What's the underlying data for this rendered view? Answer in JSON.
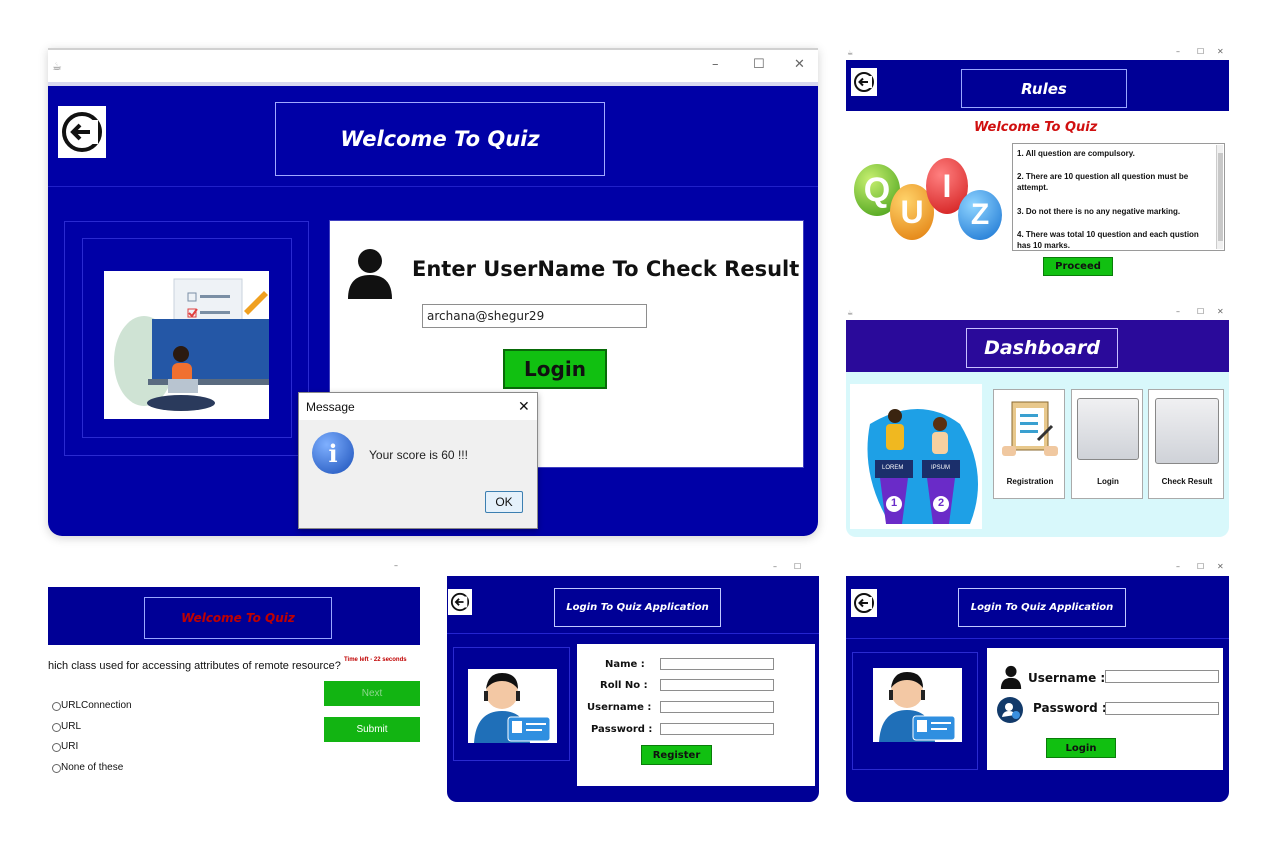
{
  "main_window": {
    "title": "Welcome To Quiz",
    "heading": "Enter UserName To Check Result",
    "username_value": "archana@shegur29",
    "login_label": "Login",
    "dialog": {
      "title": "Message",
      "close": "✕",
      "message": "Your score is 60 !!!",
      "ok_label": "OK"
    }
  },
  "rules_window": {
    "title": "Rules",
    "subtitle": "Welcome To Quiz",
    "quiz_letters": [
      "Q",
      "U",
      "I",
      "Z"
    ],
    "rules": [
      "1. All question are compulsory.",
      "2. There are 10 question all question must be attempt.",
      "3. Do not there is no any negative marking.",
      "4. There was total 10 question and each qustion has 10 marks."
    ],
    "proceed_label": "Proceed"
  },
  "dashboard_window": {
    "title": "Dashboard",
    "podium_labels": [
      "LOREM",
      "IPSUM"
    ],
    "podium_numbers": [
      "1",
      "2"
    ],
    "cards": [
      "Registration",
      "Login",
      "Check Result"
    ]
  },
  "question_window": {
    "title": "Welcome To Quiz",
    "question": "hich class used for accessing attributes of remote resource?",
    "timer": "Time left - 22 seconds",
    "options": [
      "URLConnection",
      "URL",
      "URI",
      "None of these"
    ],
    "next_label": "Next",
    "submit_label": "Submit"
  },
  "register_window": {
    "title": "Login To Quiz Application",
    "fields": [
      "Name :",
      "Roll No :",
      "Username :",
      "Password :"
    ],
    "register_label": "Register"
  },
  "login_window": {
    "title": "Login To Quiz Application",
    "username_label": "Username :",
    "password_label": "Password :",
    "login_label": "Login"
  },
  "window_controls": {
    "minimize": "–",
    "maximize": "☐",
    "close": "✕"
  },
  "colors": {
    "navy": "#0000a6",
    "green": "#11c011",
    "quiz_red": "#d01010",
    "dashboard_purple": "#2a0a9a",
    "light_cyan": "#d8f8fb"
  }
}
